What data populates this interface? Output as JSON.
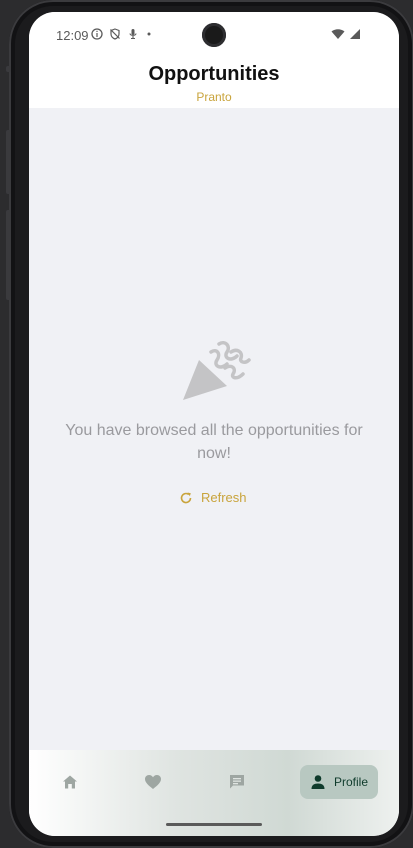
{
  "status_bar": {
    "time": "12:09"
  },
  "header": {
    "title": "Opportunities",
    "subtitle": "Pranto"
  },
  "empty_state": {
    "icon": "party-popper-icon",
    "message": "You have browsed all the opportunities for now!",
    "refresh_label": "Refresh"
  },
  "bottom_nav": {
    "items": [
      {
        "icon": "home-icon"
      },
      {
        "icon": "heart-icon"
      },
      {
        "icon": "chat-icon"
      },
      {
        "icon": "person-icon",
        "label": "Profile",
        "active": true
      }
    ]
  },
  "colors": {
    "accent": "#c9a43c",
    "nav_active_bg": "#b8c8c1",
    "nav_active_fg": "#0f3b2c",
    "background": "#f0f1f5"
  }
}
